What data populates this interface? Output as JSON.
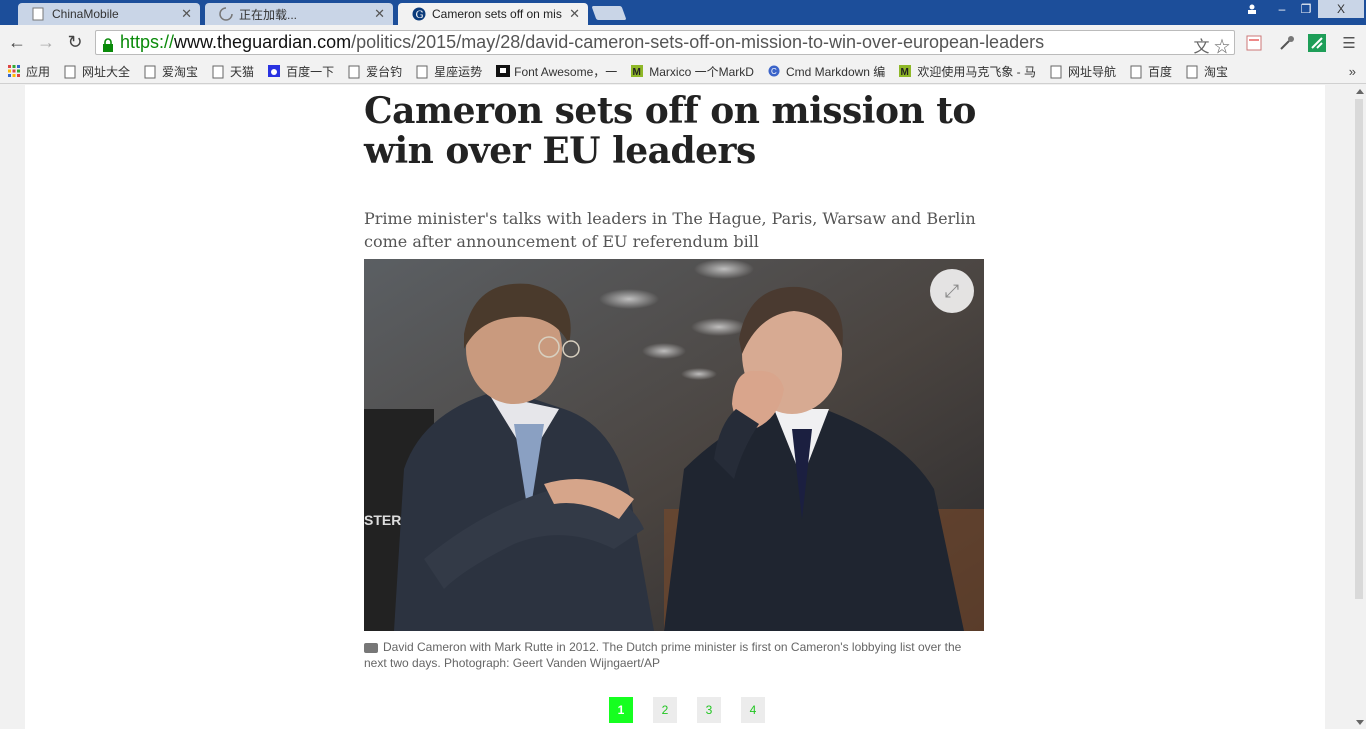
{
  "tabs": [
    {
      "label": "ChinaMobile",
      "active": false
    },
    {
      "label": "正在加载...",
      "active": false
    },
    {
      "label": "Cameron sets off on mis",
      "active": true
    }
  ],
  "window_controls": {
    "minimize": "–",
    "restore": "❐",
    "close": "X"
  },
  "omnibox": {
    "scheme": "https://",
    "host": "www.theguardian.com",
    "path": "/politics/2015/may/28/david-cameron-sets-off-on-mission-to-win-over-european-leaders"
  },
  "bookmarks": [
    {
      "label": "应用",
      "icon": "apps-grid-icon"
    },
    {
      "label": "网址大全",
      "icon": "page-icon"
    },
    {
      "label": "爱淘宝",
      "icon": "page-icon"
    },
    {
      "label": "天猫",
      "icon": "page-icon"
    },
    {
      "label": "百度一下",
      "icon": "baidu-paw-icon"
    },
    {
      "label": "爱台钓",
      "icon": "page-icon"
    },
    {
      "label": "星座运势",
      "icon": "page-icon"
    },
    {
      "label": "Font Awesome，一",
      "icon": "flag-icon"
    },
    {
      "label": "Marxico 一个MarkD",
      "icon": "m-icon"
    },
    {
      "label": "Cmd Markdown 编",
      "icon": "cmd-icon"
    },
    {
      "label": "欢迎使用马克飞象 - 马",
      "icon": "m-icon"
    },
    {
      "label": "网址导航",
      "icon": "page-icon"
    },
    {
      "label": "百度",
      "icon": "page-icon"
    },
    {
      "label": "淘宝",
      "icon": "page-icon"
    }
  ],
  "bookmarks_more": "»",
  "article": {
    "headline": "Cameron sets off on mission to win over EU leaders",
    "standfirst": "Prime minister's talks with leaders in The Hague, Paris, Warsaw and Berlin come after announcement of EU referendum bill",
    "caption": "David Cameron with Mark Rutte in 2012. The Dutch prime minister is first on Cameron's lobbying list over the next two days. Photograph: Geert Vanden Wijngaert/AP",
    "photo_overlay_text": "STER"
  },
  "pagination": [
    "1",
    "2",
    "3",
    "4"
  ],
  "colors": {
    "secure_green": "#0a8a0a",
    "pager_active": "#16ff20",
    "titlebar": "#1c4e9a"
  }
}
